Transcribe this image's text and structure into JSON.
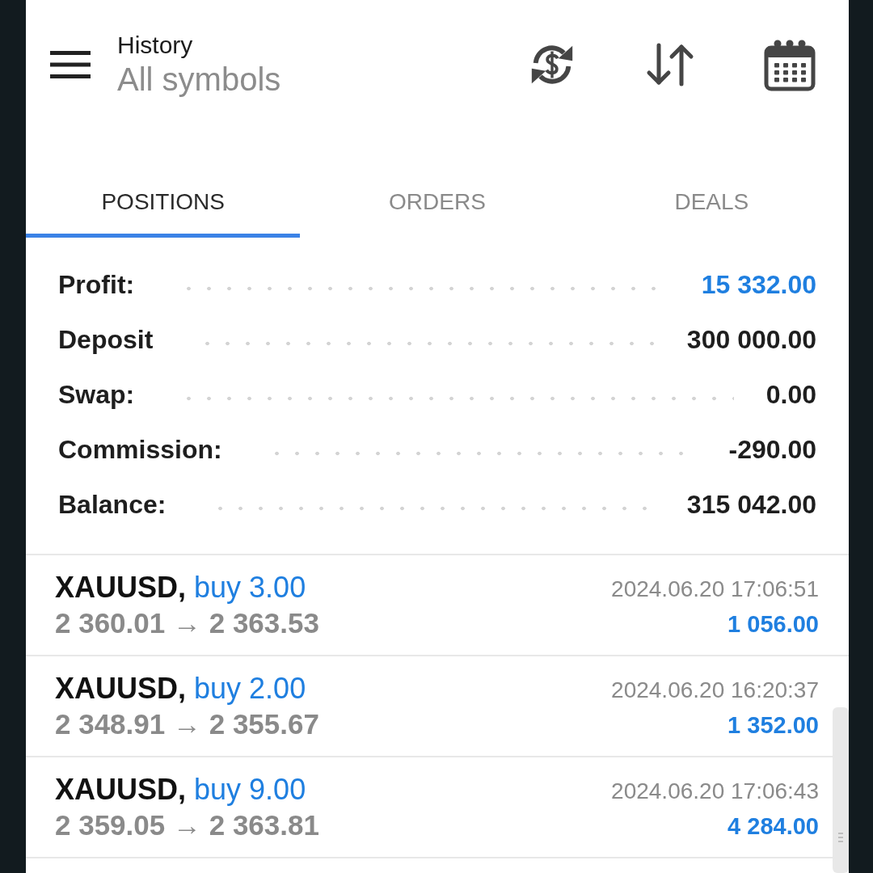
{
  "header": {
    "title": "History",
    "subtitle": "All symbols"
  },
  "tabs": [
    {
      "label": "POSITIONS",
      "selected": true
    },
    {
      "label": "ORDERS",
      "selected": false
    },
    {
      "label": "DEALS",
      "selected": false
    }
  ],
  "summary": [
    {
      "label": "Profit:",
      "value": "15 332.00",
      "kind": "profit"
    },
    {
      "label": "Deposit",
      "value": "300 000.00",
      "kind": "plain"
    },
    {
      "label": "Swap:",
      "value": "0.00",
      "kind": "plain"
    },
    {
      "label": "Commission:",
      "value": "-290.00",
      "kind": "plain"
    },
    {
      "label": "Balance:",
      "value": "315 042.00",
      "kind": "plain"
    }
  ],
  "positions": [
    {
      "symbol": "XAUUSD,",
      "side": "buy 3.00",
      "prices": "2 360.01 → 2 363.53",
      "time": "2024.06.20 17:06:51",
      "profit": "1 056.00"
    },
    {
      "symbol": "XAUUSD,",
      "side": "buy 2.00",
      "prices": "2 348.91 → 2 355.67",
      "time": "2024.06.20 16:20:37",
      "profit": "1 352.00"
    },
    {
      "symbol": "XAUUSD,",
      "side": "buy 9.00",
      "prices": "2 359.05 → 2 363.81",
      "time": "2024.06.20 17:06:43",
      "profit": "4 284.00"
    }
  ]
}
